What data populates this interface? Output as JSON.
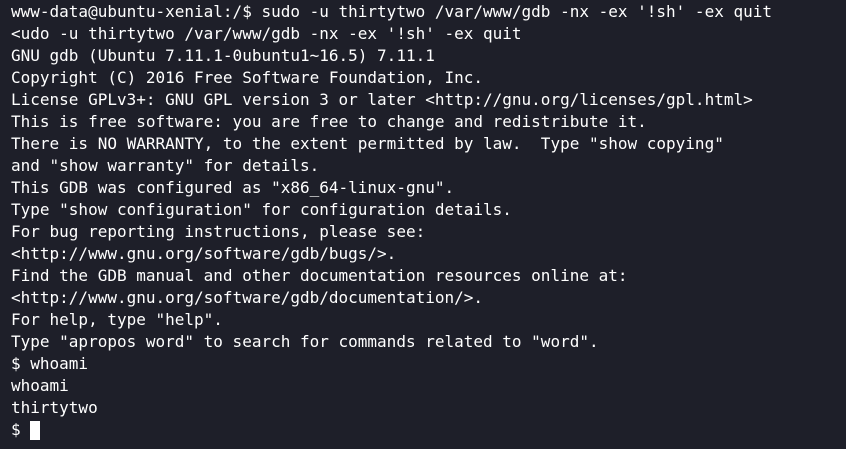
{
  "terminal": {
    "lines": [
      "www-data@ubuntu-xenial:/$ sudo -u thirtytwo /var/www/gdb -nx -ex '!sh' -ex quit",
      "<udo -u thirtytwo /var/www/gdb -nx -ex '!sh' -ex quit",
      "GNU gdb (Ubuntu 7.11.1-0ubuntu1~16.5) 7.11.1",
      "Copyright (C) 2016 Free Software Foundation, Inc.",
      "License GPLv3+: GNU GPL version 3 or later <http://gnu.org/licenses/gpl.html>",
      "This is free software: you are free to change and redistribute it.",
      "There is NO WARRANTY, to the extent permitted by law.  Type \"show copying\"",
      "and \"show warranty\" for details.",
      "This GDB was configured as \"x86_64-linux-gnu\".",
      "Type \"show configuration\" for configuration details.",
      "For bug reporting instructions, please see:",
      "<http://www.gnu.org/software/gdb/bugs/>.",
      "Find the GDB manual and other documentation resources online at:",
      "<http://www.gnu.org/software/gdb/documentation/>.",
      "For help, type \"help\".",
      "Type \"apropos word\" to search for commands related to \"word\".",
      "$ whoami",
      "whoami",
      "thirtytwo"
    ],
    "current_prompt": "$ ",
    "colors": {
      "background": "#1e1f29",
      "foreground": "#ffffff"
    }
  }
}
